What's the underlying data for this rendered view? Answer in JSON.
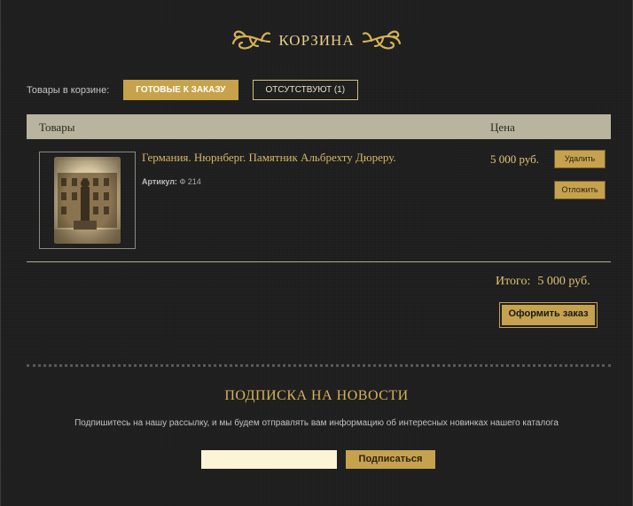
{
  "header": {
    "title": "КОРЗИНА"
  },
  "filters": {
    "label": "Товары в корзине:",
    "tab_ready": "ГОТОВЫЕ К ЗАКАЗУ",
    "tab_missing": "ОТСУТСТВУЮТ (1)"
  },
  "table": {
    "col_goods": "Товары",
    "col_price": "Цена"
  },
  "item": {
    "name": "Германия. Нюрнберг. Памятник Альбрехту Дюреру.",
    "sku_label": "Артикул:",
    "sku_value": "Ф 214",
    "price": "5 000 руб.",
    "delete_label": "Удалить",
    "postpone_label": "Отложить"
  },
  "summary": {
    "total_label": "Итого:",
    "total_value": "5 000 руб.",
    "checkout_label": "Оформить заказ"
  },
  "newsletter": {
    "title": "ПОДПИСКА НА НОВОСТИ",
    "text": "Подпишитесь на нашу рассылку, и мы будем отправлять вам информацию об интересных новинках нашего каталога",
    "email_value": "",
    "subscribe_label": "Подписаться"
  },
  "colors": {
    "accent": "#c6a24f",
    "header_bar": "#b9b49e",
    "background": "#1e1e1e",
    "title": "#d7b358"
  }
}
